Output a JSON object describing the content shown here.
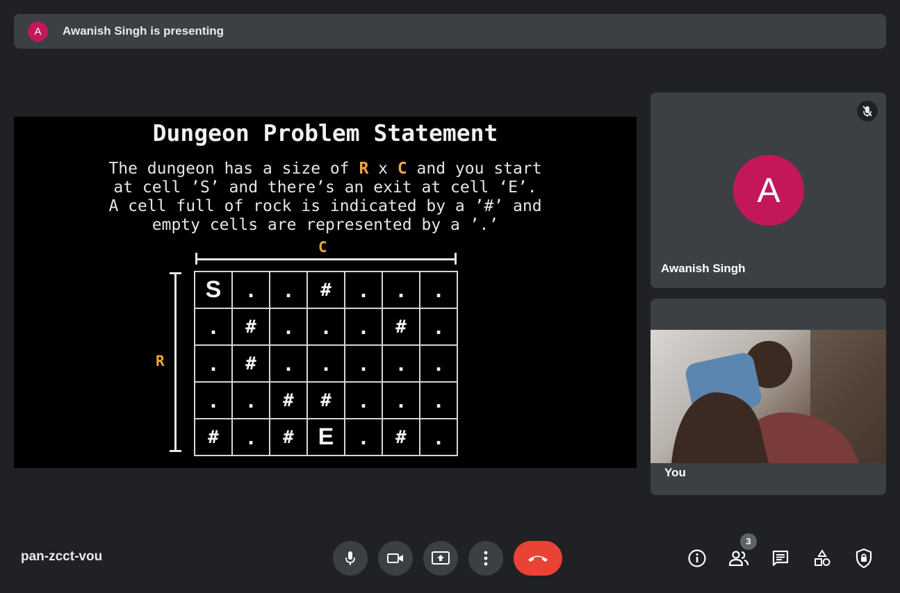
{
  "banner": {
    "avatar_letter": "A",
    "text": "Awanish Singh is presenting"
  },
  "slide": {
    "title": "Dungeon Problem Statement",
    "statement": {
      "l1a": "The dungeon has a size of ",
      "l1r": "R",
      "l1x": " x ",
      "l1c": "C",
      "l1b": " and you start",
      "l2": "at cell ’S’ and there’s an exit at cell ‘E’.",
      "l3": "A cell full of rock is indicated by a ’#’ and",
      "l4": "empty cells are represented by a ’.’"
    },
    "col_label": "C",
    "row_label": "R",
    "grid": [
      [
        "S",
        ".",
        ".",
        "#",
        ".",
        ".",
        "."
      ],
      [
        ".",
        "#",
        ".",
        ".",
        ".",
        "#",
        "."
      ],
      [
        ".",
        "#",
        ".",
        ".",
        ".",
        ".",
        "."
      ],
      [
        ".",
        ".",
        "#",
        "#",
        ".",
        ".",
        "."
      ],
      [
        "#",
        ".",
        "#",
        "E",
        ".",
        "#",
        "."
      ]
    ]
  },
  "tiles": {
    "presenter": {
      "avatar_letter": "A",
      "name": "Awanish Singh",
      "avatar_color": "#c2185b"
    },
    "self": {
      "name": "You"
    }
  },
  "meeting_code": "pan-zcct-vou",
  "participants_count": "3",
  "colors": {
    "end_call": "#ea4335",
    "surface": "#3c4043",
    "background": "#202124",
    "accent": "#f2a541"
  }
}
